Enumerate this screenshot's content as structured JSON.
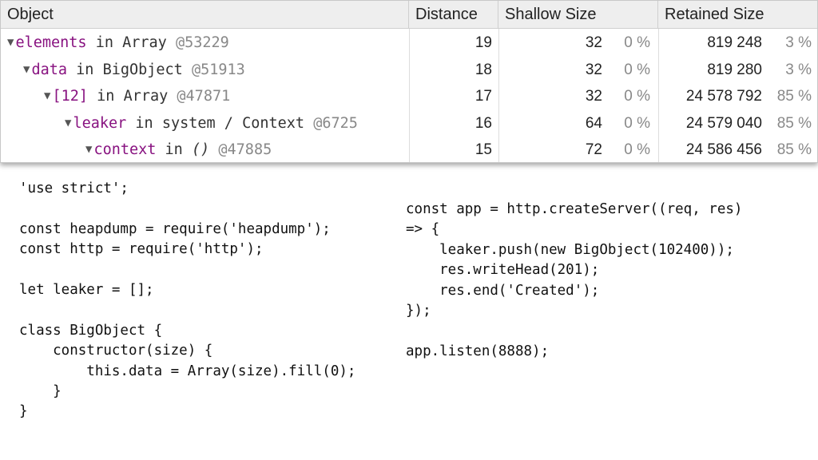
{
  "table": {
    "headers": {
      "object": "Object",
      "distance": "Distance",
      "shallow_size": "Shallow Size",
      "retained_size": "Retained Size"
    },
    "rows": [
      {
        "name": "elements",
        "connector": "in",
        "type": "Array",
        "id": "@53229",
        "distance": "19",
        "shallow": "32",
        "shallow_pct": "0 %",
        "retained": "819 248",
        "retained_pct": "3 %"
      },
      {
        "name": "data",
        "connector": "in",
        "type": "BigObject",
        "id": "@51913",
        "distance": "18",
        "shallow": "32",
        "shallow_pct": "0 %",
        "retained": "819 280",
        "retained_pct": "3 %"
      },
      {
        "name": "[12]",
        "connector": "in",
        "type": "Array",
        "id": "@47871",
        "distance": "17",
        "shallow": "32",
        "shallow_pct": "0 %",
        "retained": "24 578 792",
        "retained_pct": "85 %"
      },
      {
        "name": "leaker",
        "connector": "in",
        "type": "system / Context",
        "id": "@6725",
        "distance": "16",
        "shallow": "64",
        "shallow_pct": "0 %",
        "retained": "24 579 040",
        "retained_pct": "85 %"
      },
      {
        "name": "context",
        "connector": "in",
        "type": "()",
        "id": "@47885",
        "distance": "15",
        "shallow": "72",
        "shallow_pct": "0 %",
        "retained": "24 586 456",
        "retained_pct": "85 %"
      }
    ],
    "expand_icon": "triangle-down"
  },
  "code": {
    "left": "'use strict';\n\nconst heapdump = require('heapdump');\nconst http = require('http');\n\nlet leaker = [];\n\nclass BigObject {\n    constructor(size) {\n        this.data = Array(size).fill(0);\n    }\n}",
    "right": "const app = http.createServer((req, res)\n=> {\n    leaker.push(new BigObject(102400));\n    res.writeHead(201);\n    res.end('Created');\n});\n\napp.listen(8888);"
  },
  "colors": {
    "property_name": "#881280",
    "object_id": "#888888",
    "header_bg": "#eeeeee"
  }
}
